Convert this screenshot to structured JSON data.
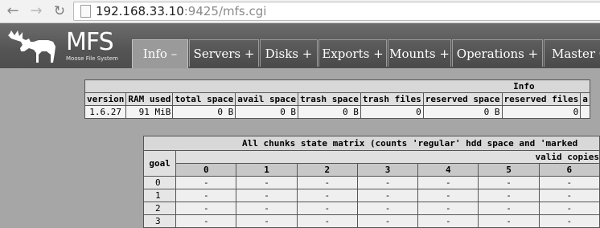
{
  "browser": {
    "url_host": "192.168.33.10",
    "url_rest": ":9425/mfs.cgi"
  },
  "logo": {
    "title": "MFS",
    "subtitle": "Moose File System"
  },
  "tabs": [
    {
      "label": "Info –"
    },
    {
      "label": "Servers +"
    },
    {
      "label": "Disks +"
    },
    {
      "label": "Exports +"
    },
    {
      "label": "Mounts +"
    },
    {
      "label": "Operations +"
    },
    {
      "label": "Master C"
    }
  ],
  "info": {
    "title": "Info",
    "headers": [
      "version",
      "RAM used",
      "total space",
      "avail space",
      "trash space",
      "trash files",
      "reserved space",
      "reserved files",
      "a"
    ],
    "values": [
      "1.6.27",
      "91 MiB",
      "0 B",
      "0 B",
      "0 B",
      "0",
      "0 B",
      "0",
      ""
    ]
  },
  "matrix": {
    "title": "All chunks state matrix (counts 'regular' hdd space and 'marked",
    "goal_label": "goal",
    "valid_copies_label": "valid copies",
    "columns": [
      "0",
      "1",
      "2",
      "3",
      "4",
      "5",
      "6"
    ],
    "rows": [
      {
        "goal": "0",
        "cells": [
          "-",
          "-",
          "-",
          "-",
          "-",
          "-",
          "-"
        ]
      },
      {
        "goal": "1",
        "cells": [
          "-",
          "-",
          "-",
          "-",
          "-",
          "-",
          "-"
        ]
      },
      {
        "goal": "2",
        "cells": [
          "-",
          "-",
          "-",
          "-",
          "-",
          "-",
          "-"
        ]
      },
      {
        "goal": "3",
        "cells": [
          "-",
          "-",
          "-",
          "-",
          "-",
          "-",
          "-"
        ]
      }
    ]
  }
}
